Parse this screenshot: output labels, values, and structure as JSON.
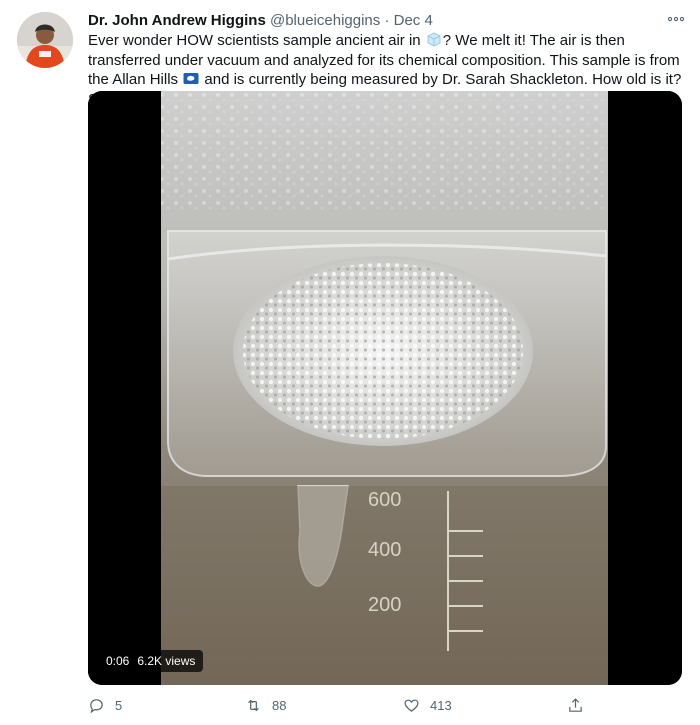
{
  "tweet": {
    "author_name": "Dr. John Andrew Higgins",
    "handle": "@blueicehiggins",
    "separator": "·",
    "date": "Dec 4",
    "text_part1": "Ever wonder HOW scientists sample ancient air in",
    "text_part2": "? We melt it! The air is then transferred under vacuum and analyzed for its chemical composition. This sample is from the Allan Hills",
    "text_part3": "and is currently being measured by Dr. Sarah Shackleton. How old is it? Stay tuned!",
    "emoji1": "ice-cube-emoji",
    "emoji2": "antarctica-flag-emoji"
  },
  "media": {
    "elapsed": "0:06",
    "views": "6.2K views",
    "beaker_labels": [
      "600",
      "400",
      "200"
    ]
  },
  "actions": {
    "reply_count": "5",
    "retweet_count": "88",
    "like_count": "413"
  },
  "colors": {
    "text": "#0f1419",
    "secondary": "#536471",
    "media_bg": "#000000"
  }
}
